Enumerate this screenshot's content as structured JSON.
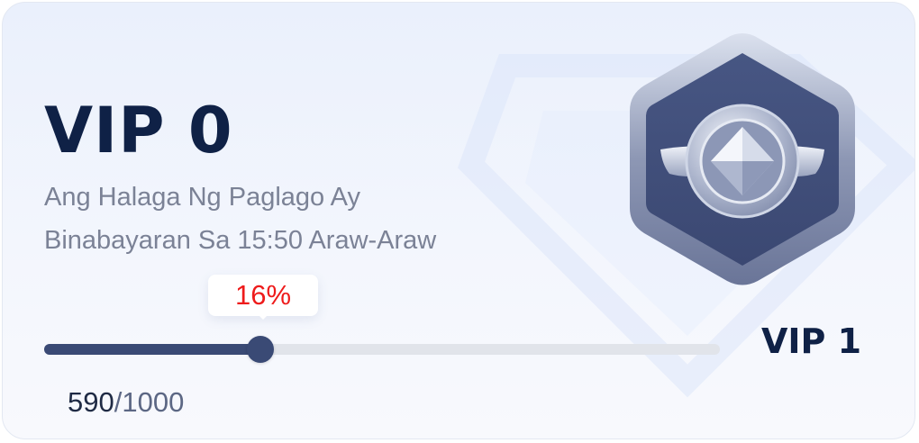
{
  "vip_card": {
    "current_level": "VIP 0",
    "description_line1": "Ang Halaga Ng Paglago Ay",
    "description_line2": "Binabayaran Sa 15:50 Araw-Araw",
    "progress_label": "16%",
    "progress_fraction": 0.32,
    "next_level": "VIP 1",
    "points_current": "590",
    "points_separator": "/",
    "points_target": "1000",
    "badge_icon": "silver-diamond-hexagon-badge-icon"
  },
  "colors": {
    "title": "#0f2146",
    "subtitle": "#7b8296",
    "progress_fill": "#3a4a75",
    "progress_track": "#e1e4ea",
    "percent_text": "#ee1b1b"
  }
}
